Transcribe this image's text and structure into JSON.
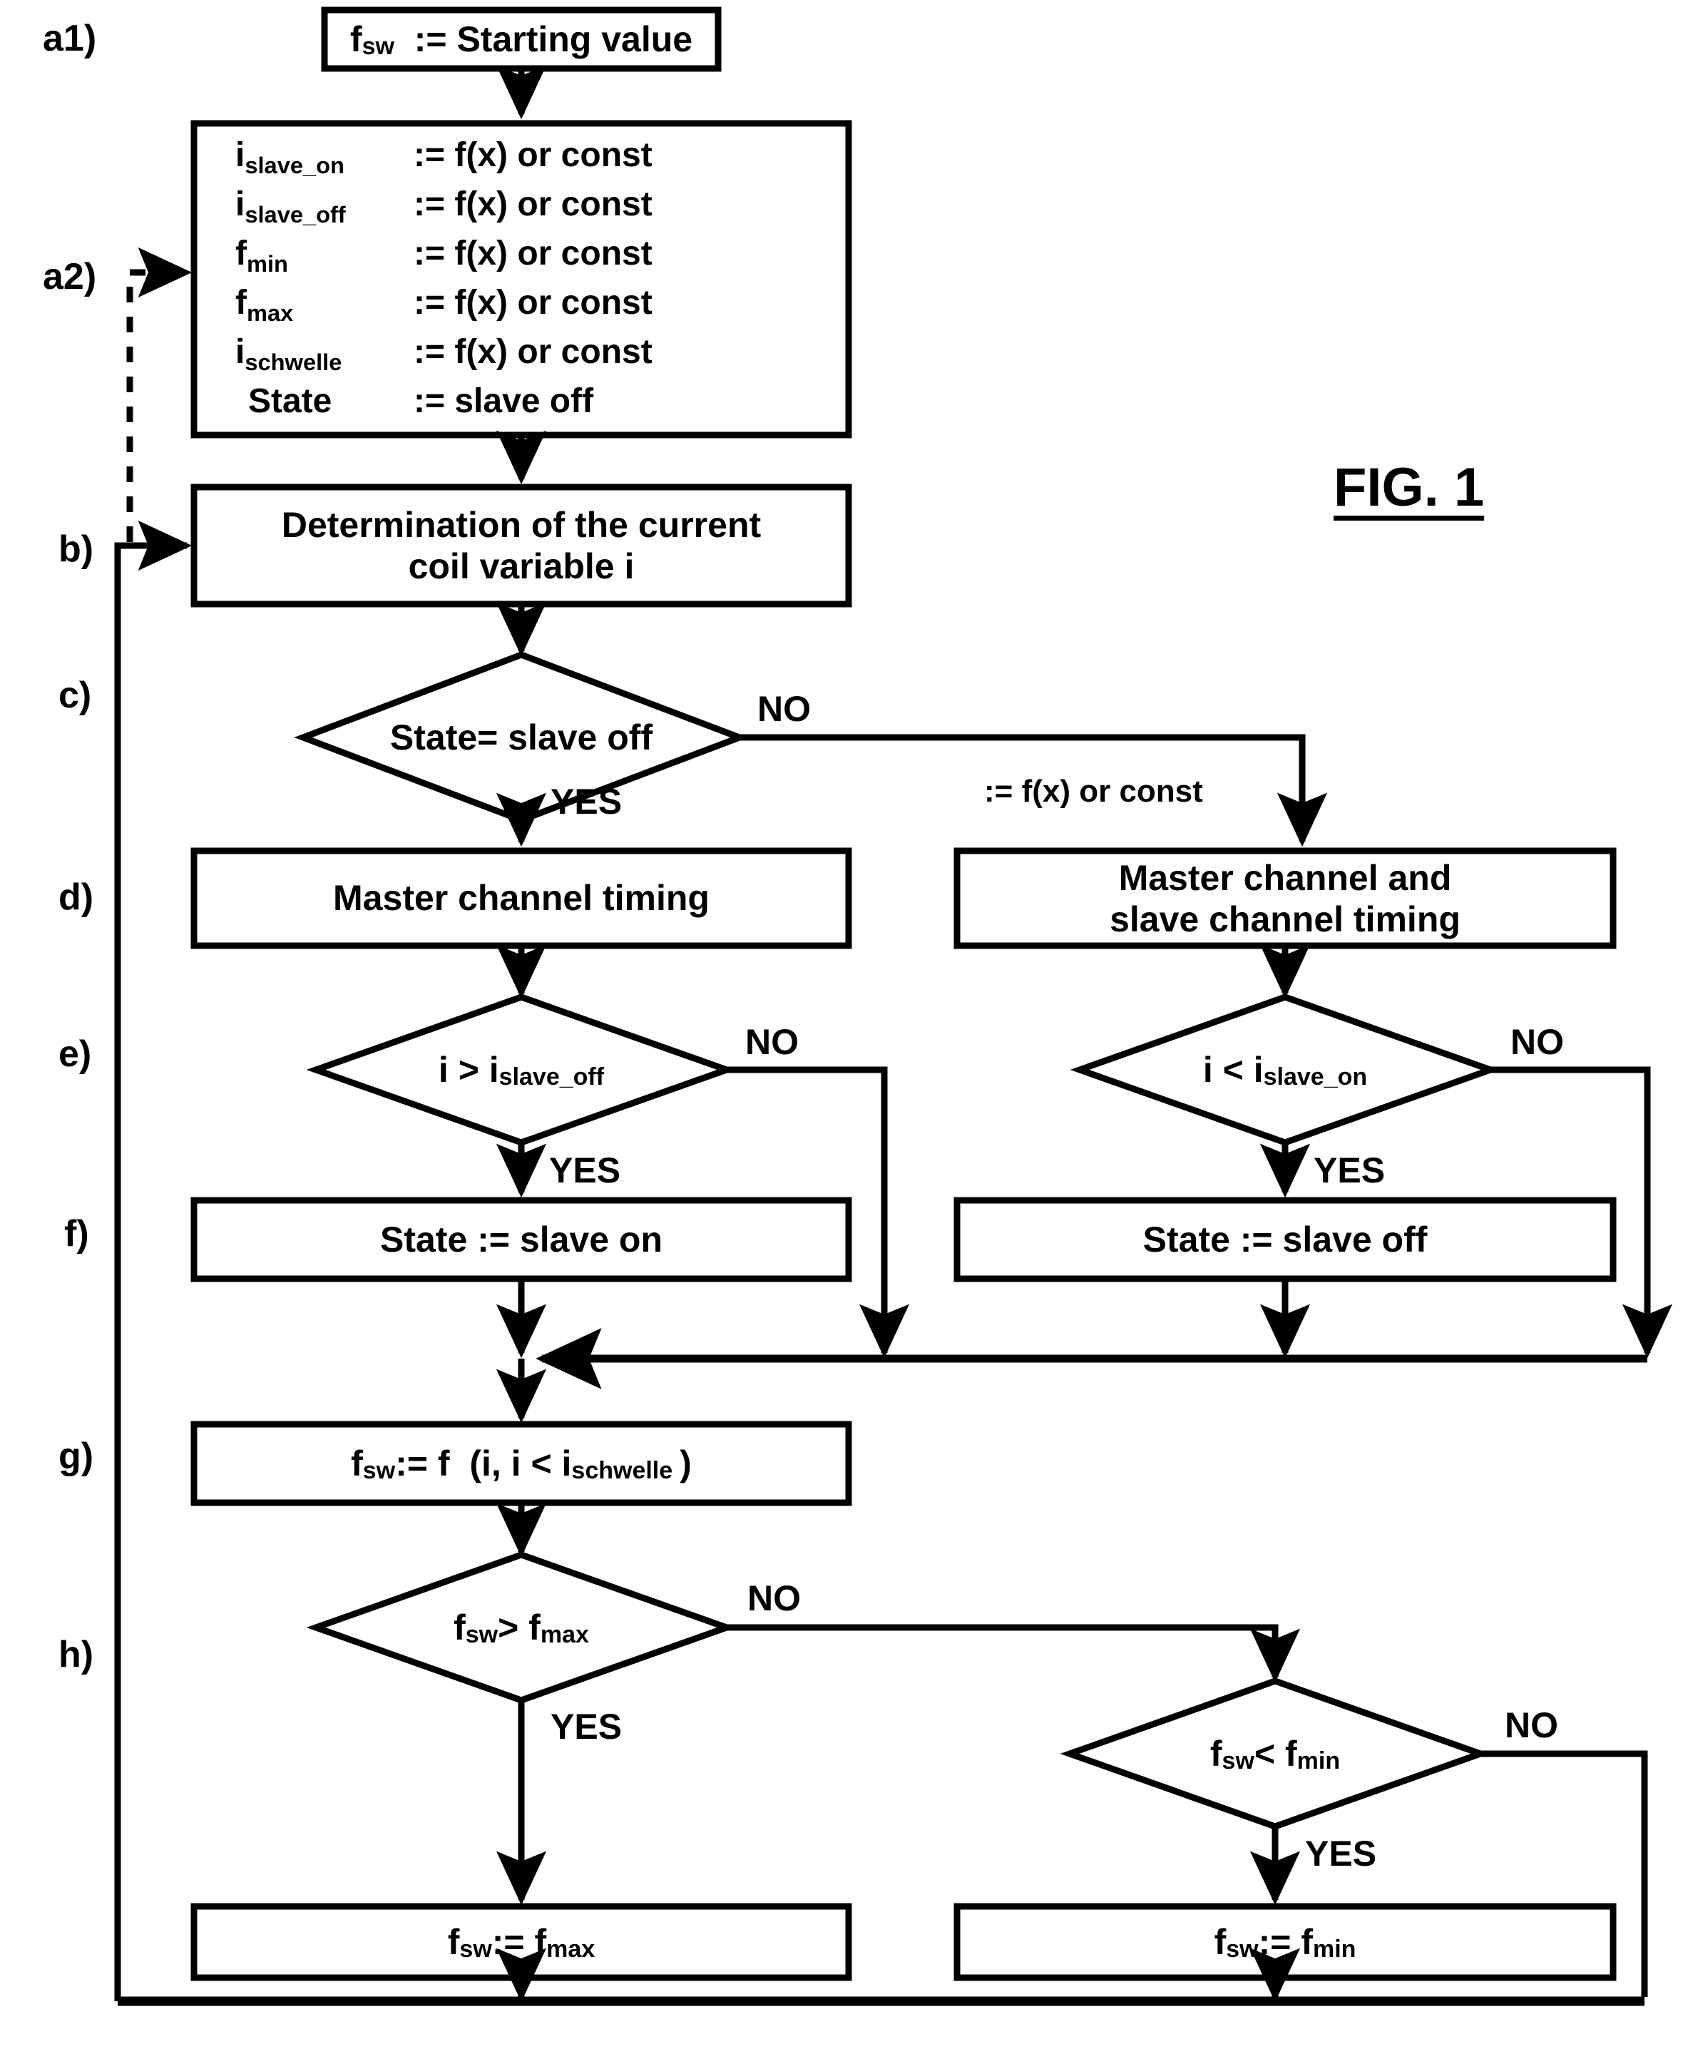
{
  "figure": {
    "title": "FIG. 1"
  },
  "step_labels": [
    {
      "id": "a1",
      "text": "a1)"
    },
    {
      "id": "a2",
      "text": "a2)"
    },
    {
      "id": "b",
      "text": "b)"
    },
    {
      "id": "c",
      "text": "c)"
    },
    {
      "id": "d",
      "text": "d)"
    },
    {
      "id": "e",
      "text": "e)"
    },
    {
      "id": "f",
      "text": "f)"
    },
    {
      "id": "g",
      "text": "g)"
    },
    {
      "id": "h",
      "text": "h)"
    }
  ],
  "nodes": {
    "a1_start": {
      "type": "process",
      "text": "f<sub>sw</sub>&nbsp;&nbsp;:= Starting value"
    },
    "a2_init_rows": [
      {
        "name": "i<sub>slave_on</sub>",
        "value": ":= f(x) or const"
      },
      {
        "name": "i<sub>slave_off</sub>",
        "value": ":= f(x) or const"
      },
      {
        "name": "f<sub>min</sub>",
        "value": ":= f(x) or const"
      },
      {
        "name": "f<sub>max</sub>",
        "value": ":= f(x) or const"
      },
      {
        "name": "i<sub>schwelle</sub>",
        "value": ":= f(x) or const"
      },
      {
        "name": "State",
        "value": ":= slave off"
      }
    ],
    "b_determine": {
      "type": "process",
      "line1": "Determination of the current",
      "line2": "coil variable i"
    },
    "c_decision": {
      "type": "decision",
      "text": "State= slave off"
    },
    "d_master": {
      "type": "process",
      "text": "Master channel timing"
    },
    "d_master_slave": {
      "type": "process",
      "line1": "Master channel and",
      "line2": "slave channel timing"
    },
    "e_left": {
      "type": "decision",
      "text": "i > i<sub>slave_off</sub>"
    },
    "e_right": {
      "type": "decision",
      "text": "i < i<sub>slave_on</sub>"
    },
    "f_left": {
      "type": "process",
      "text": "State := slave on"
    },
    "f_right": {
      "type": "process",
      "text": "State := slave off"
    },
    "g_fsw": {
      "type": "process",
      "text": "f<sub>sw</sub> := f&nbsp;&nbsp;(i, i &lt; i<sub>schwelle</sub>&thinsp;)"
    },
    "h_gt_max": {
      "type": "decision",
      "text": "f<sub>sw</sub> &gt; f<sub>max</sub>"
    },
    "h_lt_min": {
      "type": "decision",
      "text": "f<sub>sw</sub> &lt; f<sub>min</sub>"
    },
    "h_set_max": {
      "type": "process",
      "text": "f<sub>sw</sub> := f<sub>max</sub>"
    },
    "h_set_min": {
      "type": "process",
      "text": "f<sub>sw</sub> := f<sub>min</sub>"
    }
  },
  "edge_labels": [
    {
      "id": "c-no",
      "text": "NO"
    },
    {
      "id": "c-yes",
      "text": "YES"
    },
    {
      "id": "c-annot",
      "text": ":= f(x) or const"
    },
    {
      "id": "e-left-no",
      "text": "NO"
    },
    {
      "id": "e-left-yes",
      "text": "YES"
    },
    {
      "id": "e-right-no",
      "text": "NO"
    },
    {
      "id": "e-right-yes",
      "text": "YES"
    },
    {
      "id": "h-max-no",
      "text": "NO"
    },
    {
      "id": "h-max-yes",
      "text": "YES"
    },
    {
      "id": "h-min-no",
      "text": "NO"
    },
    {
      "id": "h-min-yes",
      "text": "YES"
    }
  ],
  "colors": {
    "stroke": "#000000",
    "background": "#ffffff"
  }
}
